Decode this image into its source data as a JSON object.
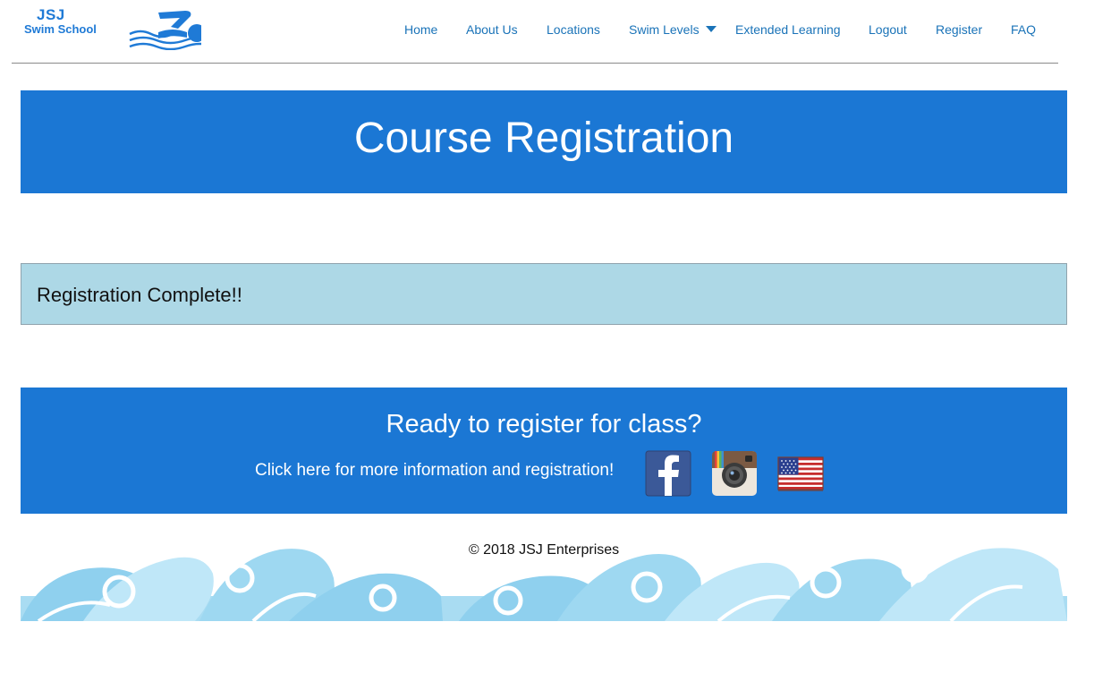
{
  "logo": {
    "line1": "JSJ",
    "line2": "Swim School",
    "brand_color": "#1f7ad6"
  },
  "nav": {
    "home": "Home",
    "about": "About Us",
    "locations": "Locations",
    "swim_levels": "Swim Levels",
    "extended": "Extended Learning",
    "logout": "Logout",
    "register": "Register",
    "faq": "FAQ",
    "dropdown_icon": "caret-down-icon"
  },
  "hero": {
    "title": "Course Registration",
    "color": "#1b77d4"
  },
  "alert": {
    "message": "Registration Complete!!",
    "color": "#add8e6"
  },
  "cta": {
    "heading": "Ready to register for class?",
    "link_text": "Click here for more information and registration!",
    "icons": [
      "facebook-icon",
      "instagram-icon",
      "us-flag-icon"
    ]
  },
  "footer": {
    "copyright": "© 2018 JSJ Enterprises"
  }
}
